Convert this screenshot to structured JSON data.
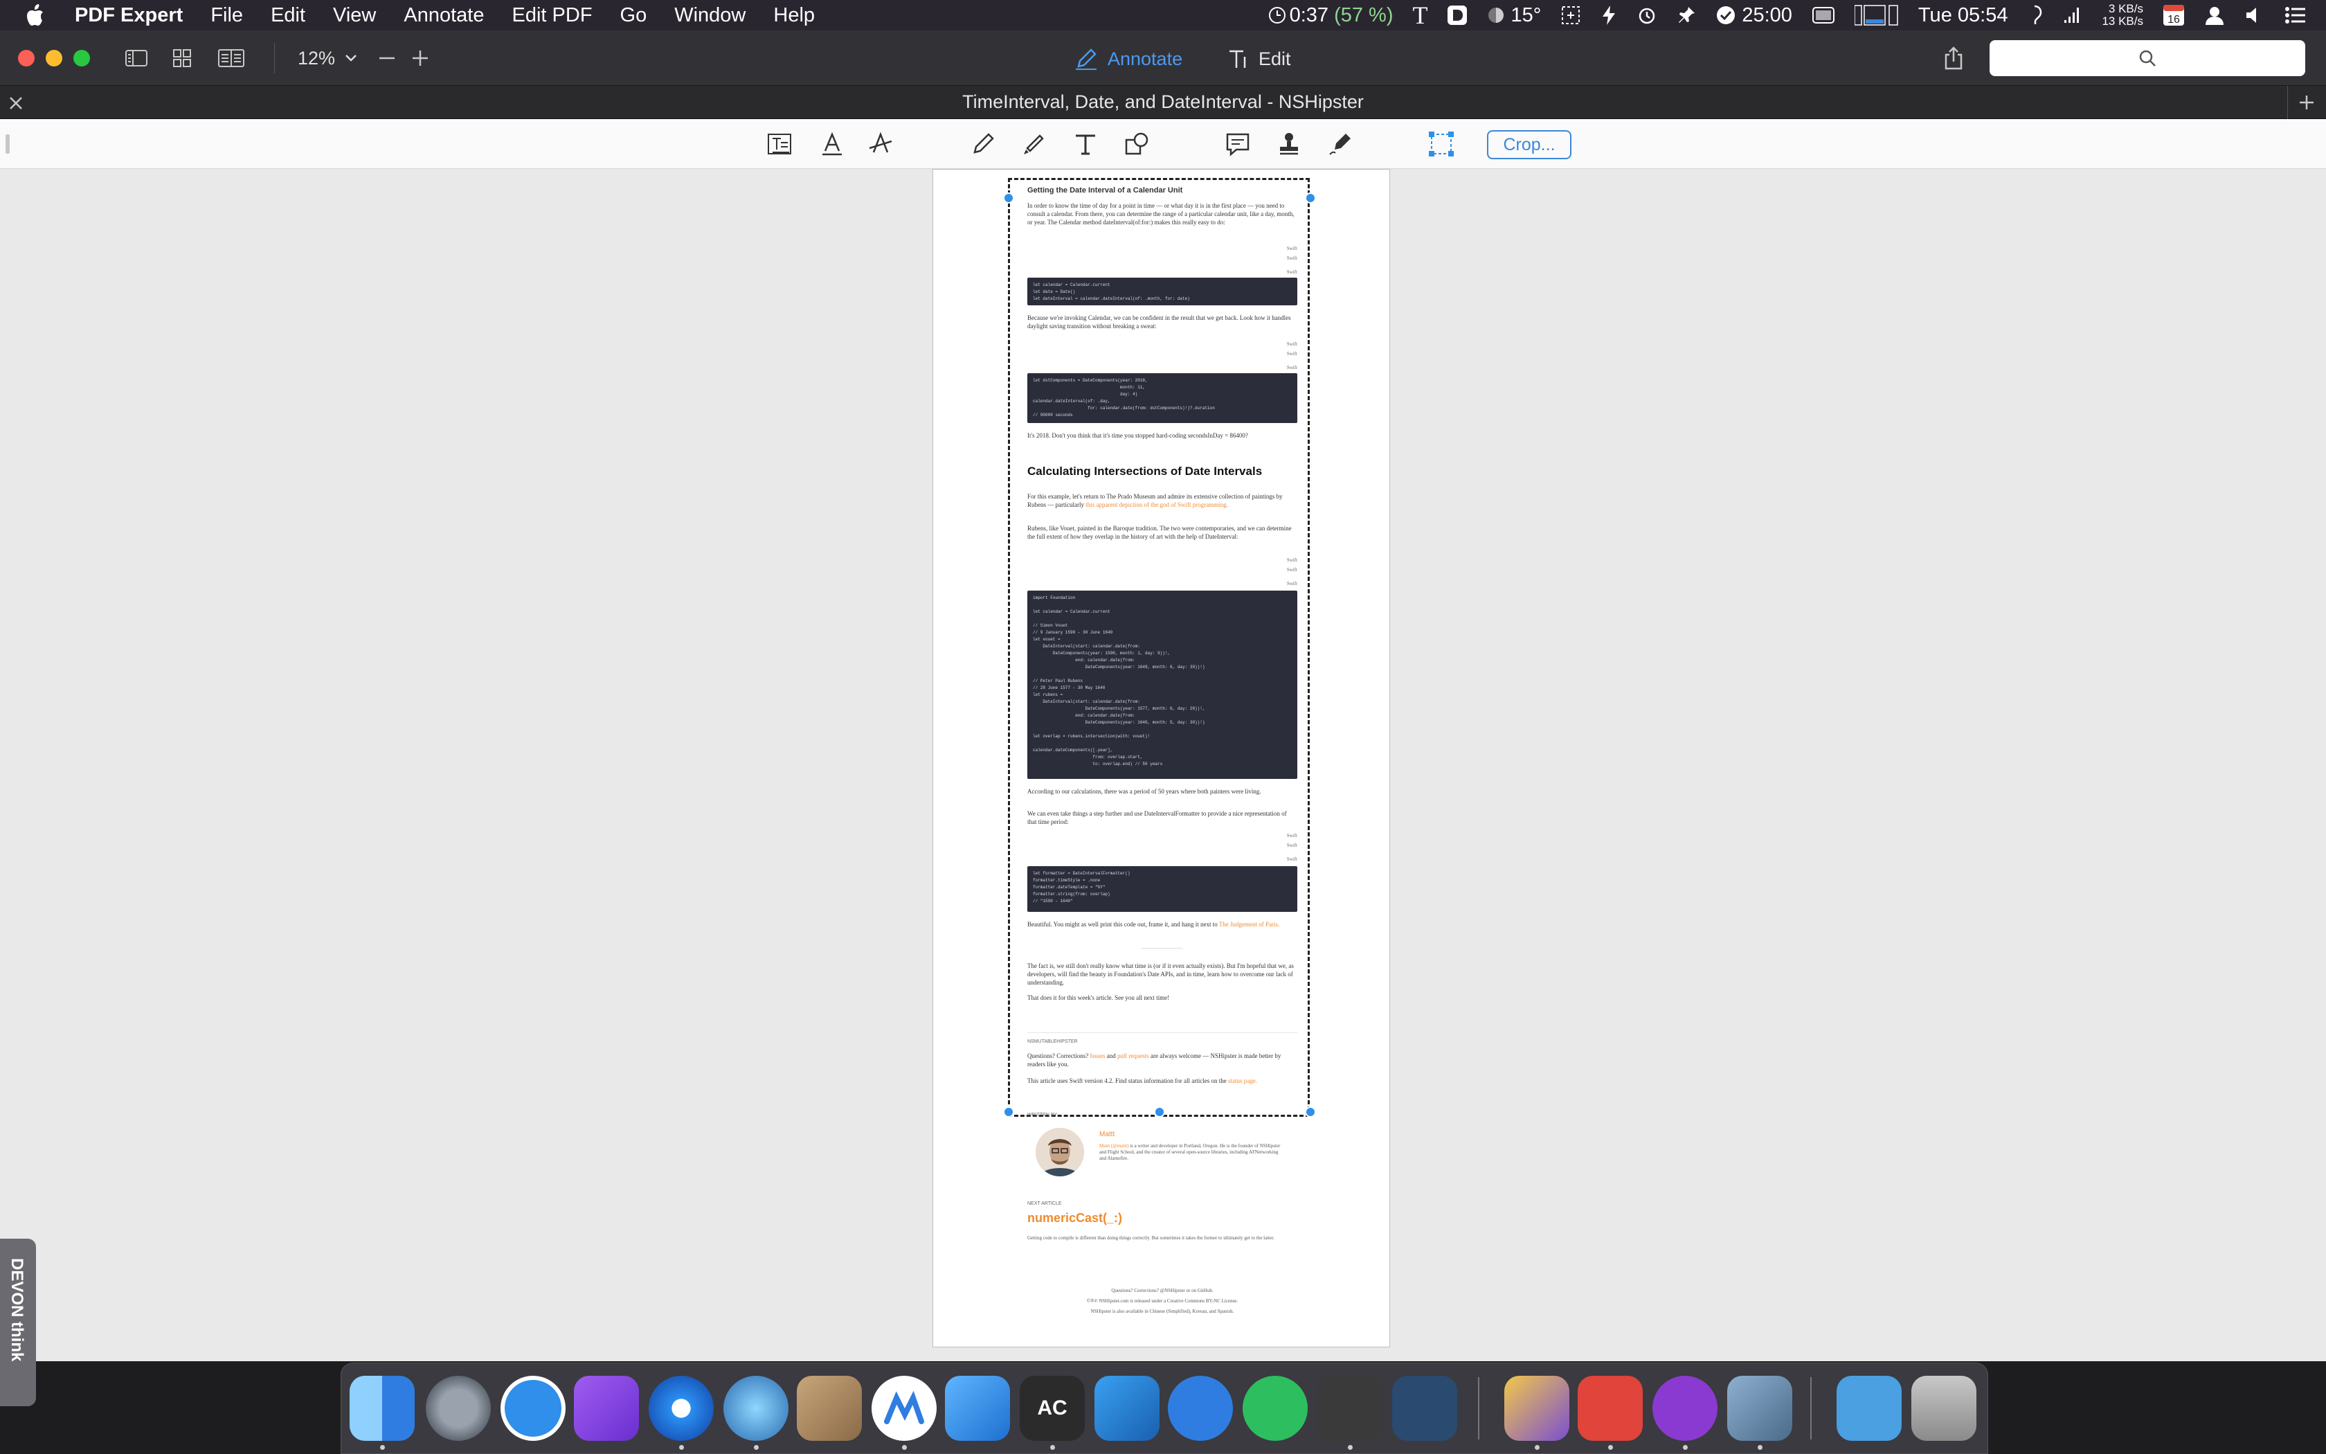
{
  "menubar": {
    "app_name": "PDF Expert",
    "items": [
      "File",
      "Edit",
      "View",
      "Annotate",
      "Edit PDF",
      "Go",
      "Window",
      "Help"
    ],
    "status": {
      "battery_time": "0:37",
      "battery_pct": "(57 %)",
      "weather": "15°",
      "timer": "25:00",
      "clock": "Tue 05:54",
      "net_up": "3 KB/s",
      "net_down": "13 KB/s",
      "calendar_day": "16"
    }
  },
  "toolbar": {
    "zoom": "12%",
    "annotate_label": "Annotate",
    "edit_label": "Edit"
  },
  "tab": {
    "title": "TimeInterval, Date, and DateInterval - NSHipster"
  },
  "annotation_bar": {
    "crop_label": "Crop..."
  },
  "document": {
    "h_getting": "Getting the Date Interval of a Calendar Unit",
    "p1": "In order to know the time of day for a point in time — or what day it is in the first place — you need to consult a calendar. From there, you can determine the range of a particular calendar unit, like a day, month, or year. The Calendar method dateInterval(of:for:) makes this really easy to do:",
    "lang": "Swift",
    "code1": "let calendar = Calendar.current\nlet date = Date()\nlet dateInterval = calendar.dateInterval(of: .month, for: date)",
    "p2": "Because we're invoking Calendar, we can be confident in the result that we get back. Look how it handles daylight saving transition without breaking a sweat:",
    "code2": "let dstComponents = DateComponents(year: 2018,\n                                   month: 11,\n                                   day: 4)\ncalendar.dateInterval(of: .day,\n                      for: calendar.date(from: dstComponents)!)?.duration\n// 90000 seconds",
    "p3": "It's 2018. Don't you think that it's time you stopped hard-coding secondsInDay = 86400?",
    "h_calc": "Calculating Intersections of Date Intervals",
    "p4": "For this example, let's return to The Prado Museum and admire its extensive collection of paintings by Rubens — particularly",
    "p4_link": "this apparent depiction of the god of Swift programming.",
    "p5": "Rubens, like Vouet, painted in the Baroque tradition. The two were contemporaries, and we can determine the full extent of how they overlap in the history of art with the help of DateInterval:",
    "code3": "import Foundation\n\nlet calendar = Calendar.current\n\n// Simon Vouet\n// 9 January 1590 – 30 June 1649\nlet vouet =\n    DateInterval(start: calendar.date(from:\n        DateComponents(year: 1590, month: 1, day: 9))!,\n                 end: calendar.date(from:\n                     DateComponents(year: 1649, month: 6, day: 30))!)\n\n// Peter Paul Rubens\n// 28 June 1577 – 30 May 1640\nlet rubens =\n    DateInterval(start: calendar.date(from:\n                     DateComponents(year: 1577, month: 6, day: 28))!,\n                 end: calendar.date(from:\n                     DateComponents(year: 1640, month: 5, day: 30))!)\n\nlet overlap = rubens.intersection(with: vouet)!\n\ncalendar.dateComponents([.year],\n                        from: overlap.start,\n                        to: overlap.end) // 50 years",
    "p6": "According to our calculations, there was a period of 50 years where both painters were living.",
    "p7": "We can even take things a step further and use DateIntervalFormatter to provide a nice representation of that time period:",
    "code4": "let formatter = DateIntervalFormatter()\nformatter.timeStyle = .none\nformatter.dateTemplate = \"%Y\"\nformatter.string(from: overlap)\n// \"1590 – 1640\"",
    "p8": "Beautiful. You might as well print this code out, frame it, and hang it next to",
    "p8_link": "The Judgement of Paris.",
    "p9": "The fact is, we still don't really know what time is (or if it even actually exists). But I'm hopeful that we, as developers, will find the beauty in Foundation's Date APIs, and in time, learn how to overcome our lack of understanding.",
    "p10": "That does it for this week's article. See you all next time!",
    "tag": "NSMUTABLEHIPSTER",
    "p11a": "Questions? Corrections?",
    "p11_issues": "Issues",
    "p11_and": "and",
    "p11_pulls": "pull requests",
    "p11b": "are always welcome — NSHipster is made better by readers like you.",
    "p12": "This article uses Swift version 4.2. Find status information for all articles on the",
    "p12_link": "status page.",
    "written_by": "WRITTEN BY",
    "author_name": "Mattt",
    "author_bio_link": "Mattt (@mattt)",
    "author_bio": "is a writer and developer in Portland, Oregon. He is the founder of NSHipster and Flight School, and the creator of several open-source libraries, including AFNetworking and Alamofire.",
    "next_article": "NEXT ARTICLE",
    "next_title": "numericCast(_:)",
    "next_desc": "Getting code to compile is different than doing things correctly. But sometimes it takes the former to ultimately get to the latter.",
    "footer1": "Questions? Corrections? @NSHipster or on GitHub.",
    "footer2": "©®℗ NSHipster.com is released under a Creative Commons BY-NC License.",
    "footer3": "NSHipster is also available in Chinese (Simplified), Korean, and Spanish."
  },
  "devon": {
    "label": "DEVON think"
  },
  "colors": {
    "accent": "#2f8fea",
    "link": "#f08b2b",
    "code_bg": "#2b2d3a"
  }
}
